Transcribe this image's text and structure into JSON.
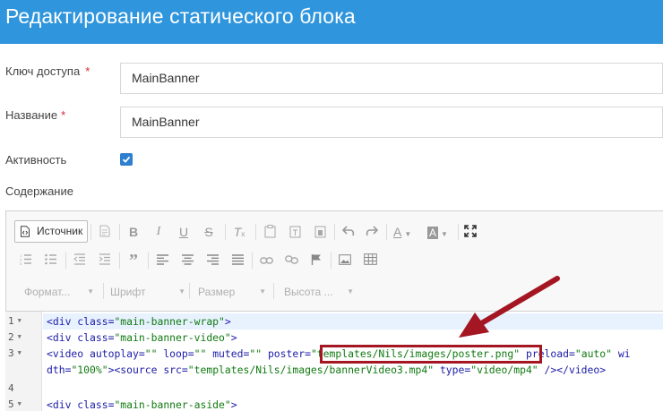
{
  "header": {
    "title": "Редактирование статического блока"
  },
  "form": {
    "access_key": {
      "label": "Ключ доступа",
      "required_mark": "*",
      "value": "MainBanner"
    },
    "name": {
      "label": "Название",
      "required_mark": "*",
      "value": "MainBanner"
    },
    "active": {
      "label": "Активность",
      "checked": true
    },
    "content": {
      "label": "Содержание"
    }
  },
  "editor": {
    "source_button": "Источник",
    "combos": {
      "format": "Формат...",
      "font": "Шрифт",
      "size": "Размер",
      "height": "Высота ..."
    },
    "code": {
      "lines": [
        {
          "num": "1",
          "fold": "▼",
          "parts": [
            [
              "tag",
              "<div "
            ],
            [
              "attr",
              "class="
            ],
            [
              "str",
              "\"main-banner-wrap\""
            ],
            [
              "tag",
              ">"
            ]
          ]
        },
        {
          "num": "2",
          "fold": "▼",
          "parts": [
            [
              "tag",
              "<div "
            ],
            [
              "attr",
              "class="
            ],
            [
              "str",
              "\"main-banner-video\""
            ],
            [
              "tag",
              ">"
            ]
          ]
        },
        {
          "num": "3",
          "fold": "▼",
          "parts": [
            [
              "tag",
              "<video "
            ],
            [
              "attr",
              "autoplay="
            ],
            [
              "str",
              "\"\" "
            ],
            [
              "attr",
              "loop="
            ],
            [
              "str",
              "\"\" "
            ],
            [
              "attr",
              "muted="
            ],
            [
              "str",
              "\"\" "
            ],
            [
              "attr",
              "poster="
            ],
            [
              "str",
              "\"templates/Nils/images/poster.png\" "
            ],
            [
              "attr",
              "preload="
            ],
            [
              "str",
              "\"auto\" "
            ],
            [
              "attr",
              "wi"
            ]
          ]
        },
        {
          "num": "",
          "fold": "",
          "parts": [
            [
              "attr",
              "dth="
            ],
            [
              "str",
              "\"100%\""
            ],
            [
              "tag",
              ">"
            ],
            [
              "tag",
              "<source "
            ],
            [
              "attr",
              "src="
            ],
            [
              "str",
              "\"templates/Nils/images/bannerVideo3.mp4\" "
            ],
            [
              "attr",
              "type="
            ],
            [
              "str",
              "\"video/mp4\" "
            ],
            [
              "tag",
              "/>"
            ],
            [
              "tag",
              "</video>"
            ]
          ]
        },
        {
          "num": "4",
          "fold": "",
          "parts": []
        },
        {
          "num": "5",
          "fold": "▼",
          "parts": [
            [
              "tag",
              "<div "
            ],
            [
              "attr",
              "class="
            ],
            [
              "str",
              "\"main-banner-aside\""
            ],
            [
              "tag",
              ">"
            ]
          ]
        }
      ]
    }
  },
  "colors": {
    "header_bg": "#2f95dc",
    "highlight": "#a31622",
    "checkbox": "#2f7fd1"
  }
}
